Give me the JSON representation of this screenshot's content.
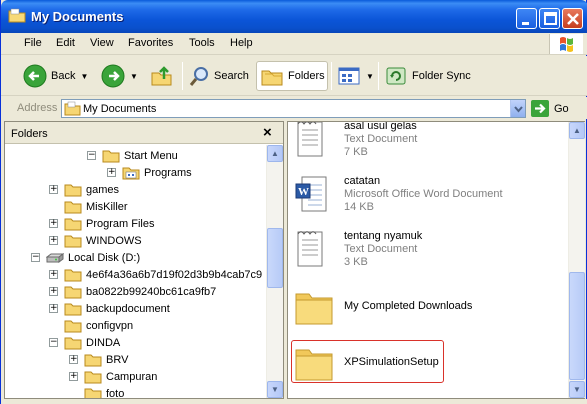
{
  "window": {
    "title": "My Documents"
  },
  "menu": {
    "items": [
      "File",
      "Edit",
      "View",
      "Favorites",
      "Tools",
      "Help"
    ]
  },
  "toolbar": {
    "back_label": "Back",
    "search_label": "Search",
    "folders_label": "Folders",
    "folder_sync_label": "Folder Sync"
  },
  "address": {
    "label": "Address",
    "value": "My Documents",
    "go_label": "Go"
  },
  "folders_pane": {
    "title": "Folders",
    "close_glyph": "×",
    "tree": [
      {
        "label": "Start Menu",
        "expander": "minus"
      },
      {
        "label": "Programs",
        "expander": "plus"
      },
      {
        "label": "games",
        "expander": "plus"
      },
      {
        "label": "MisKiller",
        "expander": ""
      },
      {
        "label": "Program Files",
        "expander": "plus"
      },
      {
        "label": "WINDOWS",
        "expander": "plus"
      },
      {
        "label": "Local Disk (D:)",
        "expander": "minus"
      },
      {
        "label": "4e6f4a36a6b7d19f02d3b9b4cab7c9",
        "expander": "plus"
      },
      {
        "label": "ba0822b99240bc61ca9fb7",
        "expander": "plus"
      },
      {
        "label": "backupdocument",
        "expander": "plus"
      },
      {
        "label": "configvpn",
        "expander": ""
      },
      {
        "label": "DINDA",
        "expander": "minus"
      },
      {
        "label": "BRV",
        "expander": "plus"
      },
      {
        "label": "Campuran",
        "expander": "plus"
      },
      {
        "label": "foto",
        "expander": ""
      }
    ]
  },
  "files": [
    {
      "name": "asal usul gelas",
      "type": "Text Document",
      "size": "7 KB",
      "icon": "text-document-icon"
    },
    {
      "name": "catatan",
      "type": "Microsoft Office Word Document",
      "size": "14 KB",
      "icon": "word-document-icon"
    },
    {
      "name": "tentang nyamuk",
      "type": "Text Document",
      "size": "3 KB",
      "icon": "text-document-icon"
    },
    {
      "name": "My Completed Downloads",
      "icon": "folder-icon"
    },
    {
      "name": "XPSimulationSetup",
      "icon": "folder-icon"
    }
  ],
  "colors": {
    "titlebar": "#0a50cc",
    "chrome": "#ece9d8",
    "selection_outline": "#d9322a",
    "folder": "#f6d673"
  }
}
